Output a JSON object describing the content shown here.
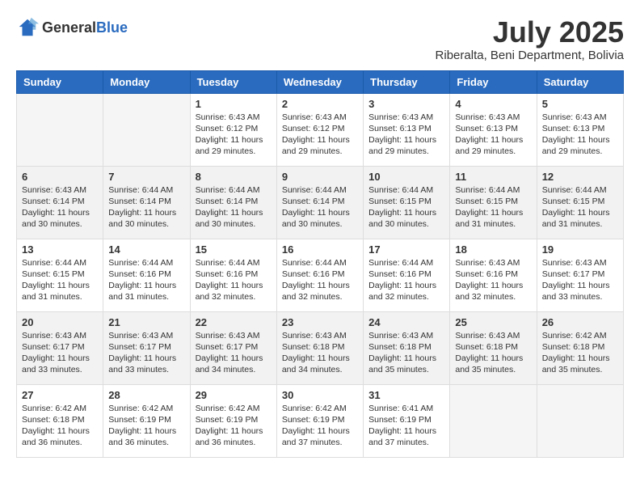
{
  "logo": {
    "general": "General",
    "blue": "Blue"
  },
  "header": {
    "month": "July 2025",
    "location": "Riberalta, Beni Department, Bolivia"
  },
  "weekdays": [
    "Sunday",
    "Monday",
    "Tuesday",
    "Wednesday",
    "Thursday",
    "Friday",
    "Saturday"
  ],
  "weeks": [
    [
      {
        "day": "",
        "sunrise": "",
        "sunset": "",
        "daylight": ""
      },
      {
        "day": "",
        "sunrise": "",
        "sunset": "",
        "daylight": ""
      },
      {
        "day": "1",
        "sunrise": "Sunrise: 6:43 AM",
        "sunset": "Sunset: 6:12 PM",
        "daylight": "Daylight: 11 hours and 29 minutes."
      },
      {
        "day": "2",
        "sunrise": "Sunrise: 6:43 AM",
        "sunset": "Sunset: 6:12 PM",
        "daylight": "Daylight: 11 hours and 29 minutes."
      },
      {
        "day": "3",
        "sunrise": "Sunrise: 6:43 AM",
        "sunset": "Sunset: 6:13 PM",
        "daylight": "Daylight: 11 hours and 29 minutes."
      },
      {
        "day": "4",
        "sunrise": "Sunrise: 6:43 AM",
        "sunset": "Sunset: 6:13 PM",
        "daylight": "Daylight: 11 hours and 29 minutes."
      },
      {
        "day": "5",
        "sunrise": "Sunrise: 6:43 AM",
        "sunset": "Sunset: 6:13 PM",
        "daylight": "Daylight: 11 hours and 29 minutes."
      }
    ],
    [
      {
        "day": "6",
        "sunrise": "Sunrise: 6:43 AM",
        "sunset": "Sunset: 6:14 PM",
        "daylight": "Daylight: 11 hours and 30 minutes."
      },
      {
        "day": "7",
        "sunrise": "Sunrise: 6:44 AM",
        "sunset": "Sunset: 6:14 PM",
        "daylight": "Daylight: 11 hours and 30 minutes."
      },
      {
        "day": "8",
        "sunrise": "Sunrise: 6:44 AM",
        "sunset": "Sunset: 6:14 PM",
        "daylight": "Daylight: 11 hours and 30 minutes."
      },
      {
        "day": "9",
        "sunrise": "Sunrise: 6:44 AM",
        "sunset": "Sunset: 6:14 PM",
        "daylight": "Daylight: 11 hours and 30 minutes."
      },
      {
        "day": "10",
        "sunrise": "Sunrise: 6:44 AM",
        "sunset": "Sunset: 6:15 PM",
        "daylight": "Daylight: 11 hours and 30 minutes."
      },
      {
        "day": "11",
        "sunrise": "Sunrise: 6:44 AM",
        "sunset": "Sunset: 6:15 PM",
        "daylight": "Daylight: 11 hours and 31 minutes."
      },
      {
        "day": "12",
        "sunrise": "Sunrise: 6:44 AM",
        "sunset": "Sunset: 6:15 PM",
        "daylight": "Daylight: 11 hours and 31 minutes."
      }
    ],
    [
      {
        "day": "13",
        "sunrise": "Sunrise: 6:44 AM",
        "sunset": "Sunset: 6:15 PM",
        "daylight": "Daylight: 11 hours and 31 minutes."
      },
      {
        "day": "14",
        "sunrise": "Sunrise: 6:44 AM",
        "sunset": "Sunset: 6:16 PM",
        "daylight": "Daylight: 11 hours and 31 minutes."
      },
      {
        "day": "15",
        "sunrise": "Sunrise: 6:44 AM",
        "sunset": "Sunset: 6:16 PM",
        "daylight": "Daylight: 11 hours and 32 minutes."
      },
      {
        "day": "16",
        "sunrise": "Sunrise: 6:44 AM",
        "sunset": "Sunset: 6:16 PM",
        "daylight": "Daylight: 11 hours and 32 minutes."
      },
      {
        "day": "17",
        "sunrise": "Sunrise: 6:44 AM",
        "sunset": "Sunset: 6:16 PM",
        "daylight": "Daylight: 11 hours and 32 minutes."
      },
      {
        "day": "18",
        "sunrise": "Sunrise: 6:43 AM",
        "sunset": "Sunset: 6:16 PM",
        "daylight": "Daylight: 11 hours and 32 minutes."
      },
      {
        "day": "19",
        "sunrise": "Sunrise: 6:43 AM",
        "sunset": "Sunset: 6:17 PM",
        "daylight": "Daylight: 11 hours and 33 minutes."
      }
    ],
    [
      {
        "day": "20",
        "sunrise": "Sunrise: 6:43 AM",
        "sunset": "Sunset: 6:17 PM",
        "daylight": "Daylight: 11 hours and 33 minutes."
      },
      {
        "day": "21",
        "sunrise": "Sunrise: 6:43 AM",
        "sunset": "Sunset: 6:17 PM",
        "daylight": "Daylight: 11 hours and 33 minutes."
      },
      {
        "day": "22",
        "sunrise": "Sunrise: 6:43 AM",
        "sunset": "Sunset: 6:17 PM",
        "daylight": "Daylight: 11 hours and 34 minutes."
      },
      {
        "day": "23",
        "sunrise": "Sunrise: 6:43 AM",
        "sunset": "Sunset: 6:18 PM",
        "daylight": "Daylight: 11 hours and 34 minutes."
      },
      {
        "day": "24",
        "sunrise": "Sunrise: 6:43 AM",
        "sunset": "Sunset: 6:18 PM",
        "daylight": "Daylight: 11 hours and 35 minutes."
      },
      {
        "day": "25",
        "sunrise": "Sunrise: 6:43 AM",
        "sunset": "Sunset: 6:18 PM",
        "daylight": "Daylight: 11 hours and 35 minutes."
      },
      {
        "day": "26",
        "sunrise": "Sunrise: 6:42 AM",
        "sunset": "Sunset: 6:18 PM",
        "daylight": "Daylight: 11 hours and 35 minutes."
      }
    ],
    [
      {
        "day": "27",
        "sunrise": "Sunrise: 6:42 AM",
        "sunset": "Sunset: 6:18 PM",
        "daylight": "Daylight: 11 hours and 36 minutes."
      },
      {
        "day": "28",
        "sunrise": "Sunrise: 6:42 AM",
        "sunset": "Sunset: 6:19 PM",
        "daylight": "Daylight: 11 hours and 36 minutes."
      },
      {
        "day": "29",
        "sunrise": "Sunrise: 6:42 AM",
        "sunset": "Sunset: 6:19 PM",
        "daylight": "Daylight: 11 hours and 36 minutes."
      },
      {
        "day": "30",
        "sunrise": "Sunrise: 6:42 AM",
        "sunset": "Sunset: 6:19 PM",
        "daylight": "Daylight: 11 hours and 37 minutes."
      },
      {
        "day": "31",
        "sunrise": "Sunrise: 6:41 AM",
        "sunset": "Sunset: 6:19 PM",
        "daylight": "Daylight: 11 hours and 37 minutes."
      },
      {
        "day": "",
        "sunrise": "",
        "sunset": "",
        "daylight": ""
      },
      {
        "day": "",
        "sunrise": "",
        "sunset": "",
        "daylight": ""
      }
    ]
  ]
}
